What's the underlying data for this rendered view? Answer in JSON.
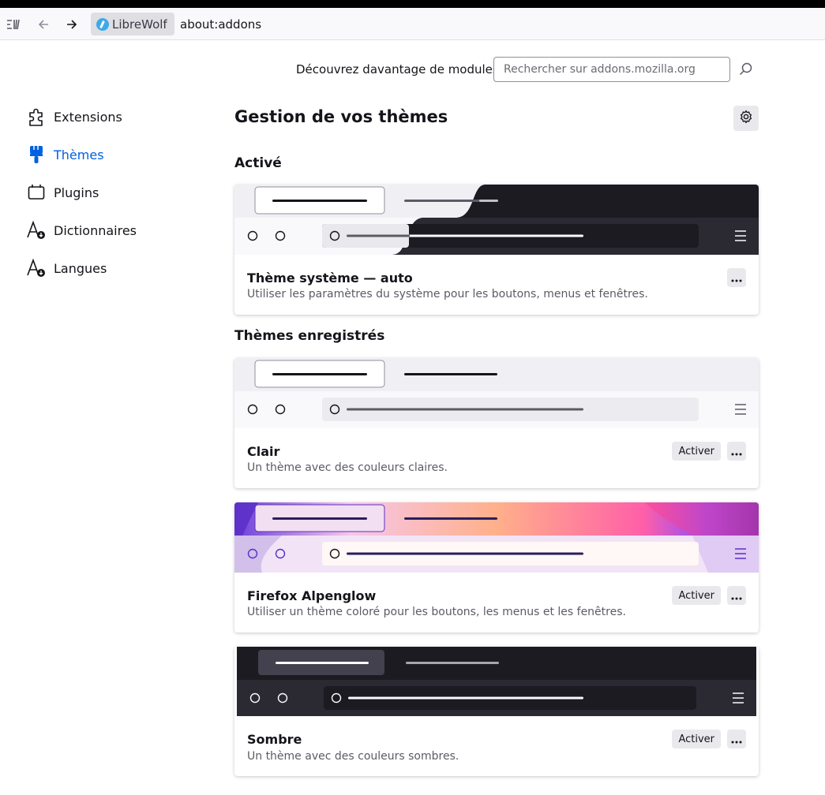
{
  "browser": {
    "identity_label": "LibreWolf",
    "url": "about:addons"
  },
  "header": {
    "discover_label": "Découvrez davantage de modules",
    "search_placeholder": "Rechercher sur addons.mozilla.org"
  },
  "sidebar": {
    "items": [
      {
        "label": "Extensions",
        "icon": "puzzle-icon",
        "active": false
      },
      {
        "label": "Thèmes",
        "icon": "brush-icon",
        "active": true
      },
      {
        "label": "Plugins",
        "icon": "plugin-icon",
        "active": false
      },
      {
        "label": "Dictionnaires",
        "icon": "dictionary-icon",
        "active": false
      },
      {
        "label": "Langues",
        "icon": "language-icon",
        "active": false
      }
    ]
  },
  "main": {
    "title": "Gestion de vos thèmes",
    "active_section": "Activé",
    "saved_section": "Thèmes enregistrés",
    "enable_label": "Activer",
    "themes": [
      {
        "name": "Thème système — auto",
        "description": "Utiliser les paramètres du système pour les boutons, menus et fenêtres.",
        "active": true
      },
      {
        "name": "Clair",
        "description": "Un thème avec des couleurs claires.",
        "active": false
      },
      {
        "name": "Firefox Alpenglow",
        "description": "Utiliser un thème coloré pour les boutons, les menus et les fenêtres.",
        "active": false
      },
      {
        "name": "Sombre",
        "description": "Un thème avec des couleurs sombres.",
        "active": false
      }
    ]
  },
  "colors": {
    "accent": "#0061e0",
    "dark_theme": "#1c1b22",
    "light_tab_bar": "#f0f0f4"
  }
}
